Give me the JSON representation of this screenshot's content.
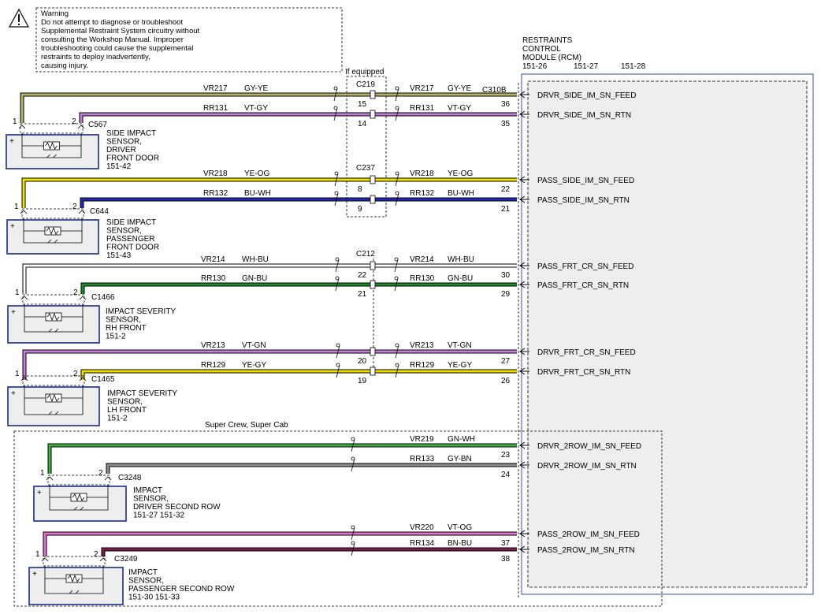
{
  "warning": {
    "lines": [
      "Warning",
      "Do not attempt to diagnose or troubleshoot",
      "Supplemental Restraint System circuitry without",
      "consulting the Workshop Manual. Improper",
      "troubleshooting could cause the supplemental",
      "restraints to deploy inadvertently,",
      "causing injury."
    ]
  },
  "module": {
    "title": [
      "RESTRAINTS",
      "CONTROL",
      "MODULE (RCM)"
    ],
    "refs": [
      "151-26",
      "151-27",
      "151-28"
    ],
    "connector": "C310B"
  },
  "if_equipped": "If equipped",
  "inline_connectors": [
    "C219",
    "C237",
    "C212"
  ],
  "super_label": "Super Crew, Super Cab",
  "colors": {
    "GY-YE": "#b4b46c",
    "VT-GY": "#c07cd6",
    "YE-OG": "#f2e600",
    "BU-WH": "#1f2bb0",
    "WH-BU": "#ffffff",
    "GN-BU": "#1e8a2a",
    "VT-GN": "#c97fd9",
    "YE-GY": "#f0e000",
    "GN-WH": "#3fb23f",
    "GY-BN": "#8c8c8c",
    "VT-OG": "#e66fd2",
    "BN-BU": "#7a1f4b"
  },
  "wires": [
    {
      "circuit": "VR217",
      "color": "GY-YE",
      "inline_pin": "15",
      "rcm_pin": "36",
      "signal": "DRVR_SIDE_IM_SN_FEED"
    },
    {
      "circuit": "RR131",
      "color": "VT-GY",
      "inline_pin": "14",
      "rcm_pin": "35",
      "signal": "DRVR_SIDE_IM_SN_RTN"
    },
    {
      "circuit": "VR218",
      "color": "YE-OG",
      "inline_pin": "8",
      "rcm_pin": "22",
      "signal": "PASS_SIDE_IM_SN_FEED"
    },
    {
      "circuit": "RR132",
      "color": "BU-WH",
      "inline_pin": "9",
      "rcm_pin": "21",
      "signal": "PASS_SIDE_IM_SN_RTN"
    },
    {
      "circuit": "VR214",
      "color": "WH-BU",
      "inline_pin": "22",
      "rcm_pin": "30",
      "signal": "PASS_FRT_CR_SN_FEED"
    },
    {
      "circuit": "RR130",
      "color": "GN-BU",
      "inline_pin": "21",
      "rcm_pin": "29",
      "signal": "PASS_FRT_CR_SN_RTN"
    },
    {
      "circuit": "VR213",
      "color": "VT-GN",
      "inline_pin": "20",
      "rcm_pin": "27",
      "signal": "DRVR_FRT_CR_SN_FEED"
    },
    {
      "circuit": "RR129",
      "color": "YE-GY",
      "inline_pin": "19",
      "rcm_pin": "26",
      "signal": "DRVR_FRT_CR_SN_RTN"
    },
    {
      "circuit": "VR219",
      "color": "GN-WH",
      "inline_pin": "",
      "rcm_pin": "23",
      "signal": "DRVR_2ROW_IM_SN_FEED"
    },
    {
      "circuit": "RR133",
      "color": "GY-BN",
      "inline_pin": "",
      "rcm_pin": "24",
      "signal": "DRVR_2ROW_IM_SN_RTN"
    },
    {
      "circuit": "VR220",
      "color": "VT-OG",
      "inline_pin": "",
      "rcm_pin": "37",
      "signal": "PASS_2ROW_IM_SN_FEED"
    },
    {
      "circuit": "RR134",
      "color": "BN-BU",
      "inline_pin": "",
      "rcm_pin": "38",
      "signal": "PASS_2ROW_IM_SN_RTN"
    }
  ],
  "sensors": [
    {
      "connector": "C567",
      "pins": [
        "1",
        "2"
      ],
      "label": [
        "SIDE IMPACT",
        "SENSOR,",
        "DRIVER",
        "FRONT DOOR",
        "151-42"
      ]
    },
    {
      "connector": "C644",
      "pins": [
        "1",
        "2"
      ],
      "label": [
        "SIDE IMPACT",
        "SENSOR,",
        "PASSENGER",
        "FRONT DOOR",
        "151-43"
      ]
    },
    {
      "connector": "C1466",
      "pins": [
        "1",
        "2"
      ],
      "label": [
        "IMPACT SEVERITY",
        "SENSOR,",
        "RH FRONT",
        "151-2"
      ]
    },
    {
      "connector": "C1465",
      "pins": [
        "1",
        "2"
      ],
      "label": [
        "IMPACT SEVERITY",
        "SENSOR,",
        "LH FRONT",
        "151-2"
      ]
    },
    {
      "connector": "C3248",
      "pins": [
        "1",
        "2"
      ],
      "label": [
        "IMPACT",
        "SENSOR,",
        "DRIVER SECOND ROW",
        "151-27    151-32"
      ]
    },
    {
      "connector": "C3249",
      "pins": [
        "1",
        "2"
      ],
      "label": [
        "IMPACT",
        "SENSOR,",
        "PASSENGER SECOND ROW",
        "151-30    151-33"
      ]
    }
  ]
}
